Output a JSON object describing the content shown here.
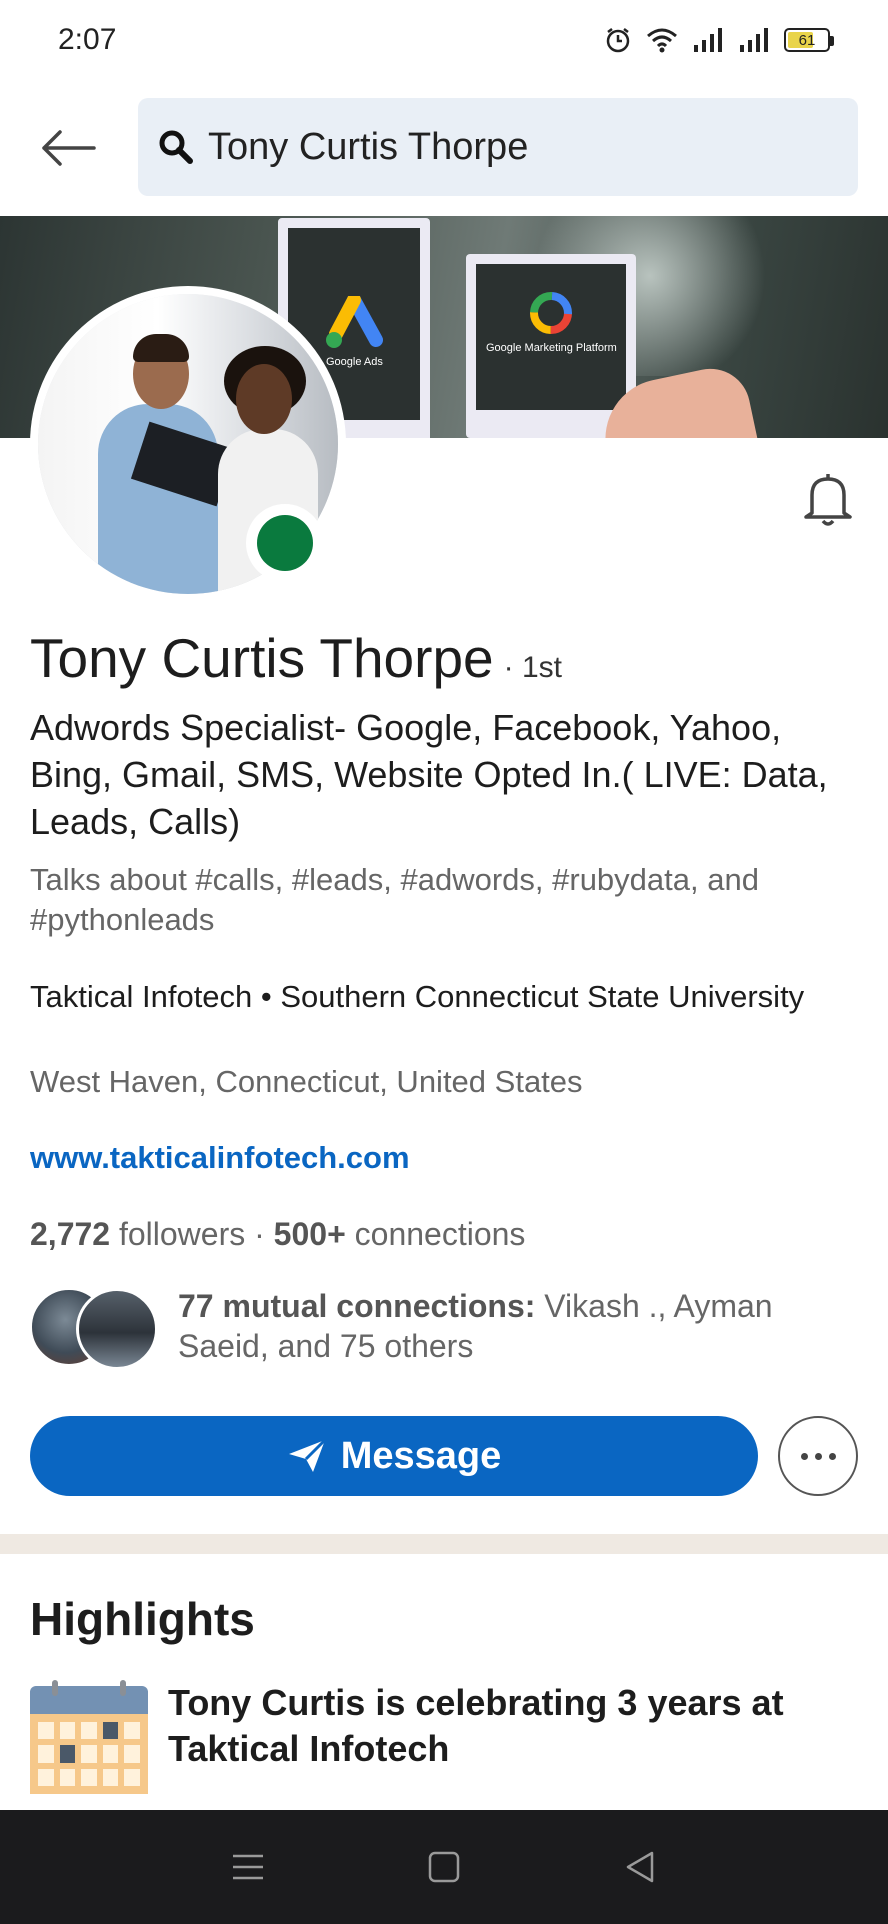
{
  "status_bar": {
    "time": "2:07",
    "battery_level": "61",
    "icons": [
      "alarm-icon",
      "wifi-icon",
      "signal-icon",
      "signal-icon",
      "battery-icon"
    ]
  },
  "search": {
    "query": "Tony Curtis Thorpe"
  },
  "banner": {
    "card1_label": "Google Ads",
    "card2_label": "Google Marketing Platform"
  },
  "profile": {
    "name": "Tony Curtis Thorpe",
    "degree": "· 1st",
    "headline": "Adwords Specialist- Google, Facebook, Yahoo, Bing, Gmail, SMS, Website Opted In.( LIVE: Data, Leads, Calls)",
    "talks_about": "Talks about #calls, #leads, #adwords, #rubydata, and #pythonleads",
    "work": "Taktical Infotech • Southern Connecticut State University",
    "location": "West Haven, Connecticut, United States",
    "website": "www.takticalinfotech.com",
    "followers_count": "2,772",
    "followers_label": "followers",
    "separator": "·",
    "connections_count": "500+",
    "connections_label": "connections",
    "mutual_bold": "77 mutual connections:",
    "mutual_rest": "Vikash ., Ayman Saeid, and 75 others"
  },
  "actions": {
    "message_label": "Message",
    "more_icon": "more-horizontal-icon"
  },
  "highlights": {
    "title": "Highlights",
    "item_text": "Tony Curtis is celebrating 3 years at Taktical Infotech"
  },
  "colors": {
    "linkedin_blue": "#0a66c2",
    "online_green": "#0a7a3e",
    "search_bg": "#e9eff6",
    "divider": "#efe9e2",
    "nav_bar": "#1b1b1d"
  }
}
